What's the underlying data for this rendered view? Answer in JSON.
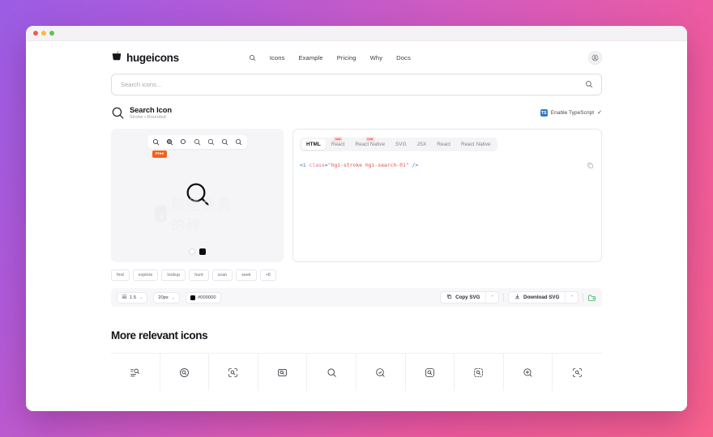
{
  "window": {
    "traffic_lights": [
      "red",
      "yellow",
      "green"
    ]
  },
  "header": {
    "brand_name": "hugeicons",
    "brand_icon": "bucket-logo-icon",
    "search_icon": "search-icon",
    "nav": [
      {
        "label": "Icons"
      },
      {
        "label": "Example"
      },
      {
        "label": "Pricing"
      },
      {
        "label": "Why"
      },
      {
        "label": "Docs"
      }
    ],
    "avatar_icon": "user-avatar-icon"
  },
  "search": {
    "placeholder": "Search icons...",
    "value": "",
    "submit_icon": "search-icon"
  },
  "icon_detail": {
    "preview_icon": "search-icon",
    "title": "Search Icon",
    "subtitle": "Stroke • Rounded",
    "typescript": {
      "badge": "TS",
      "label": "Enable TypeScript",
      "checked": true,
      "check_glyph": "✓"
    },
    "variants": [
      {
        "name": "stroke-rounded",
        "selected": false
      },
      {
        "name": "solid-rounded",
        "selected": true
      },
      {
        "name": "bulk-rounded",
        "selected": false
      },
      {
        "name": "duotone-rounded",
        "selected": false
      },
      {
        "name": "twotone-rounded",
        "selected": false
      },
      {
        "name": "stroke-sharp",
        "selected": false
      },
      {
        "name": "solid-sharp",
        "selected": false
      }
    ],
    "free_badge": "Free",
    "watermark_text": "那些免费的砖",
    "swatches": [
      {
        "name": "white-swatch",
        "color": "#ffffff"
      },
      {
        "name": "black-swatch",
        "color": "#0d0d10"
      }
    ],
    "tags": [
      "find",
      "explore",
      "lookup",
      "hunt",
      "scan",
      "seek",
      "+8"
    ]
  },
  "code": {
    "tabs": [
      {
        "label": "HTML",
        "active": true,
        "badge": ""
      },
      {
        "label": "React",
        "active": false,
        "badge": "new"
      },
      {
        "label": "React Native",
        "active": false,
        "badge": "new"
      },
      {
        "label": "SVG",
        "active": false,
        "badge": ""
      },
      {
        "label": "JSX",
        "active": false,
        "badge": ""
      },
      {
        "label": "React",
        "active": false,
        "badge": ""
      },
      {
        "label": "React Native",
        "active": false,
        "badge": ""
      }
    ],
    "snippet": {
      "open": "<i ",
      "attr": "class",
      "eq": "=",
      "value": "\"hgi-stroke hgi-search-01\"",
      "close": " />"
    },
    "copy_icon": "copy-icon"
  },
  "toolbar": {
    "stroke_width": "1.5",
    "stroke_icon": "stroke-width-icon",
    "size": "20px",
    "color": "#000000",
    "color_value": "#000000",
    "chevron": "⌄",
    "copy_svg": {
      "label": "Copy SVG",
      "icon": "copy-icon",
      "chevron": "⌃"
    },
    "download_svg": {
      "label": "Download SVG",
      "icon": "download-icon",
      "chevron": "⌃"
    },
    "folder_icon": "folder-add-icon"
  },
  "more": {
    "title": "More relevant icons",
    "icons": [
      {
        "name": "search-list-icon"
      },
      {
        "name": "search-circle-icon"
      },
      {
        "name": "search-focus-icon"
      },
      {
        "name": "search-area-icon"
      },
      {
        "name": "search-01-icon"
      },
      {
        "name": "search-visual-icon"
      },
      {
        "name": "search-square-icon"
      },
      {
        "name": "search-dashed-icon"
      },
      {
        "name": "search-add-icon"
      },
      {
        "name": "search-crop-icon"
      }
    ]
  }
}
